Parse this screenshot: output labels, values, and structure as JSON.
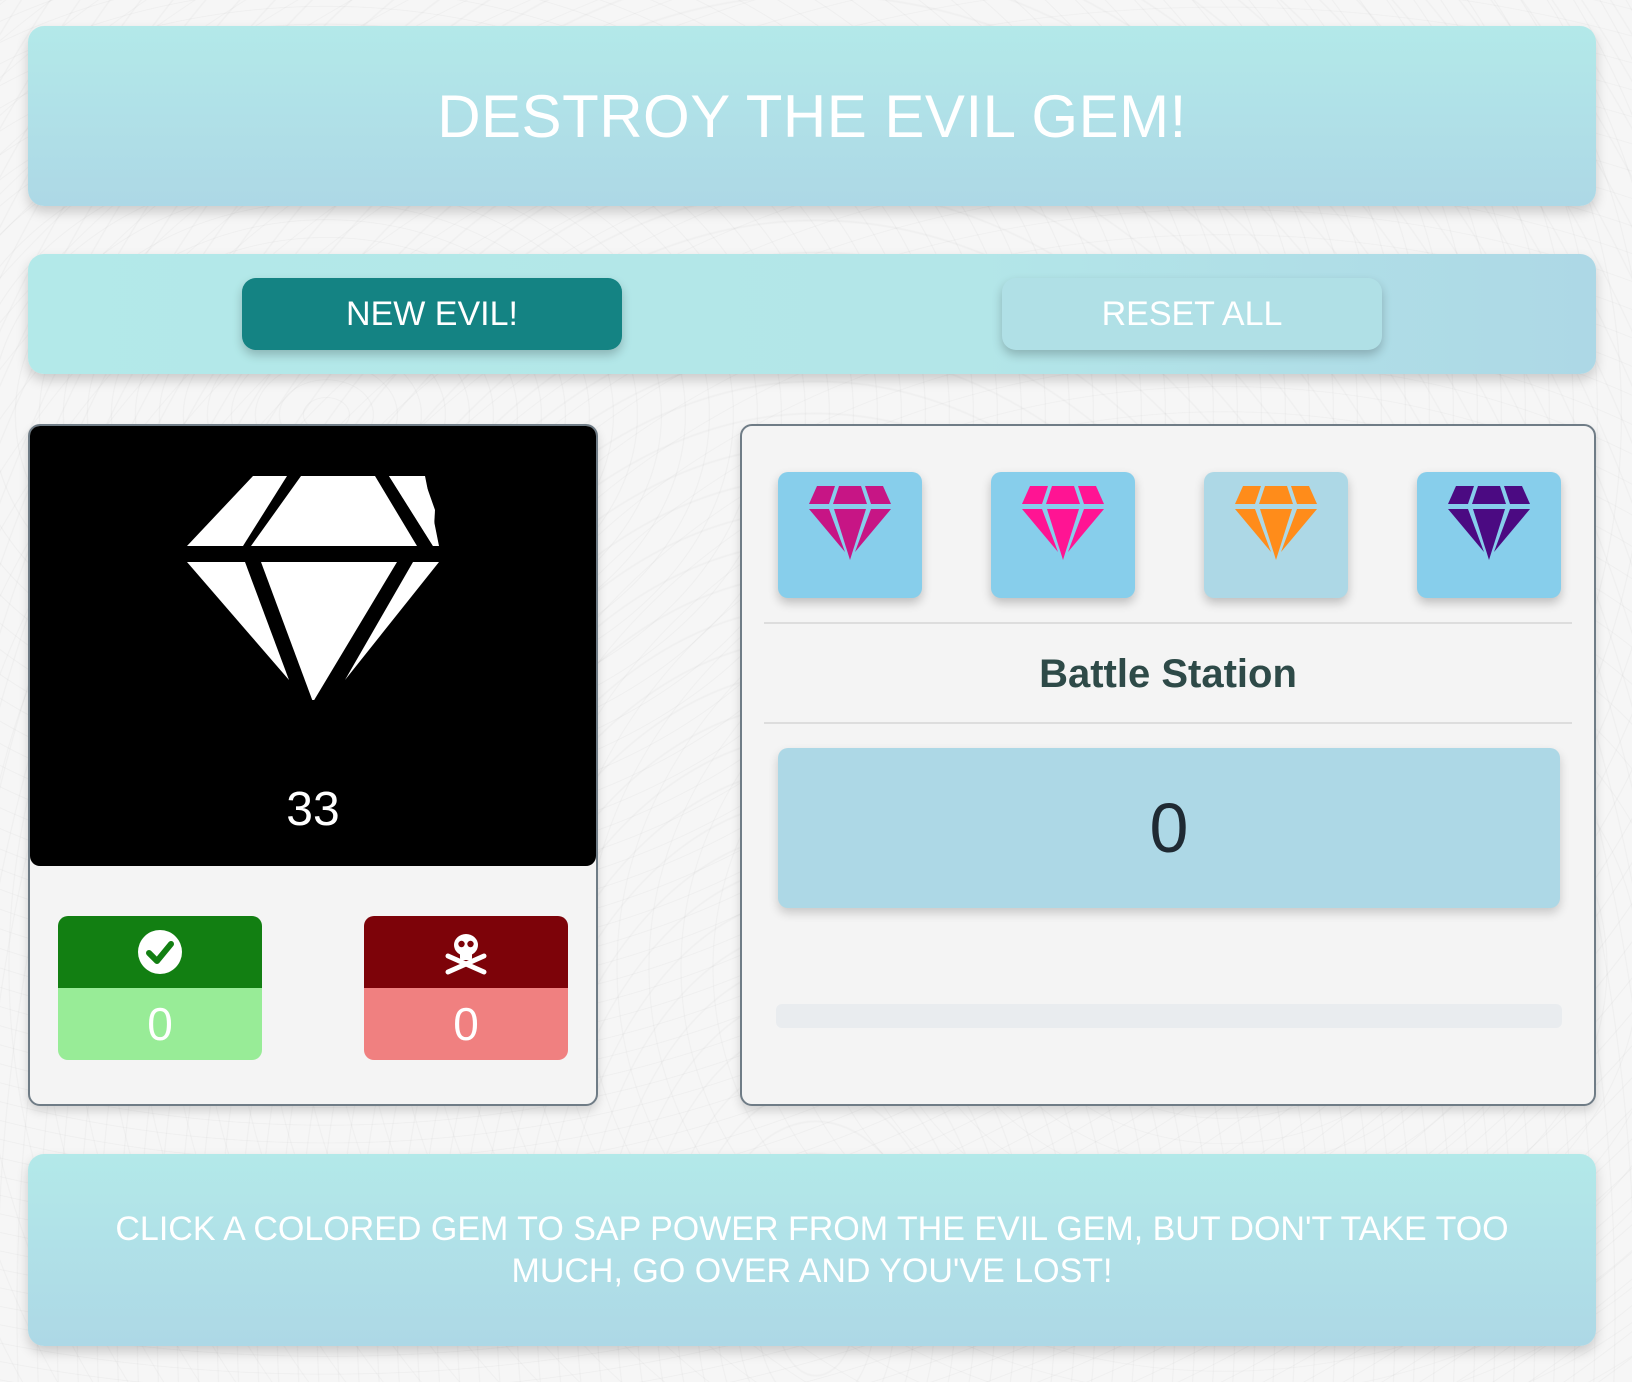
{
  "header": {
    "title": "DESTROY THE EVIL GEM!"
  },
  "controls": {
    "new_evil_label": "NEW EVIL!",
    "reset_all_label": "RESET ALL"
  },
  "evil_gem": {
    "icon": "gem-icon",
    "color": "#ffffff",
    "target_value": "33"
  },
  "tally": {
    "wins": {
      "icon": "check-circle-icon",
      "value": "0"
    },
    "losses": {
      "icon": "skull-crossbones-icon",
      "value": "0"
    }
  },
  "battle_station": {
    "title": "Battle Station",
    "gems": [
      {
        "icon": "gem-icon",
        "color": "#c71585",
        "bg": "#87ceeb"
      },
      {
        "icon": "gem-icon",
        "color": "#ff1493",
        "bg": "#87ceeb"
      },
      {
        "icon": "gem-icon",
        "color": "#ff8c1a",
        "bg": "#add8e6"
      },
      {
        "icon": "gem-icon",
        "color": "#4b0a82",
        "bg": "#87ceeb"
      }
    ],
    "score": "0",
    "progress_fraction": 0
  },
  "footer": {
    "instructions": "CLICK A COLORED GEM TO SAP POWER FROM THE EVIL GEM, BUT DON'T TAKE TOO MUCH, GO OVER AND YOU'VE LOST!"
  }
}
